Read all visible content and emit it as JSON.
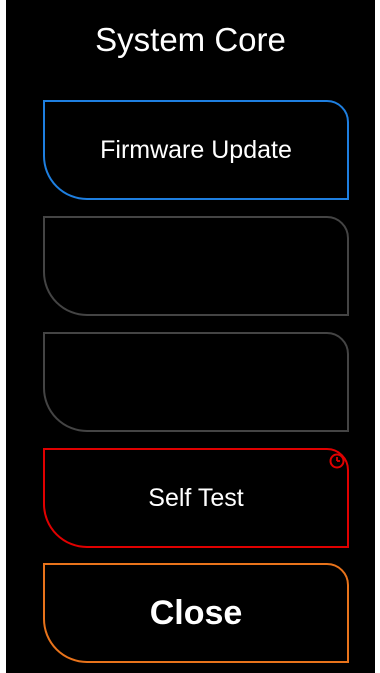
{
  "panel": {
    "title": "System Core"
  },
  "buttons": [
    {
      "label": "Firmware Update",
      "accent": "#1e7fe0"
    },
    {
      "label": "",
      "accent": "#444444"
    },
    {
      "label": "",
      "accent": "#444444"
    },
    {
      "label": "Self Test",
      "accent": "#e00000",
      "icon": "clock-icon"
    },
    {
      "label": "Close",
      "accent": "#e8731b"
    }
  ]
}
